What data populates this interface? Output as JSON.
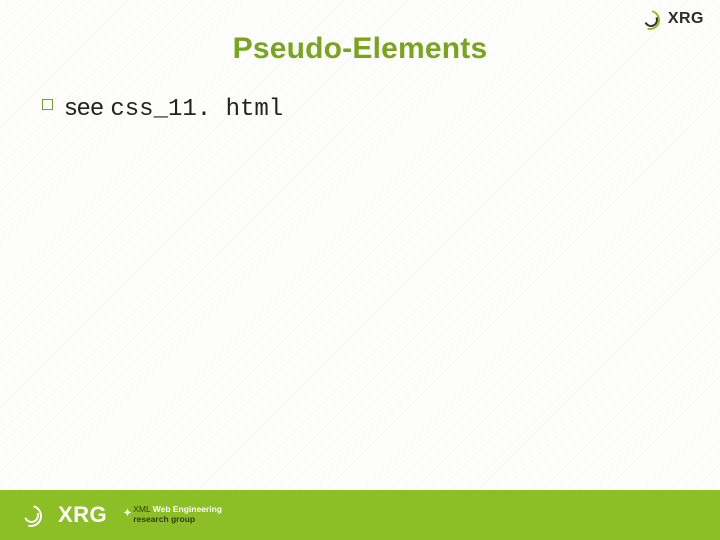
{
  "title": "Pseudo-Elements",
  "bullets": [
    {
      "prefix": "see ",
      "code": "css_11. html"
    }
  ],
  "logo": {
    "brand": "XRG",
    "sub_line1_prefix": "XML ",
    "sub_line1_bold": "Web Engineering",
    "sub_line2": "research group"
  }
}
